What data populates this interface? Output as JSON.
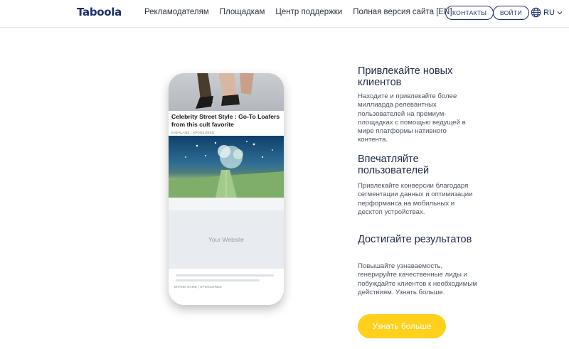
{
  "header": {
    "logo": "Taboola",
    "nav": [
      "Рекламодателям",
      "Площадкам",
      "Центр поддержки",
      "Полная версия сайта [EN]"
    ],
    "contacts_label": "КОНТАКТЫ",
    "login_label": "ВОЙТИ",
    "lang": "RU",
    "globe_icon": "globe-icon",
    "chevron_icon": "chevron-down-icon"
  },
  "phone": {
    "ad_title": "Celebrity Street Style : Go-To Loafers from this cult favorite",
    "ad_meta": "EVERLANE | SPONSORED",
    "site_label": "Your Website",
    "bottom_meta": "BRAND NAME | SPONSORED"
  },
  "features": [
    {
      "title": "Привлекайте новых клиентов",
      "desc": "Находите и привлекайте более миллиарда релевантных пользователей на премиум-площадках с помощью ведущей в мире платформы нативного контента."
    },
    {
      "title": "Впечатляйте пользователей",
      "desc": "Привлекайте конверсии благодаря сегментации данных и оптимизации перформанса на мобильных и десктоп устройствах."
    },
    {
      "title": "Достигайте результатов",
      "desc": "Повышайте узнаваемость, генерируйте качественные лиды и побуждайте клиентов к необходимым действиям. Узнать больше."
    }
  ],
  "cta_label": "Узнать больше",
  "colors": {
    "brand": "#1b2e6b",
    "cta": "#ffd11c"
  }
}
